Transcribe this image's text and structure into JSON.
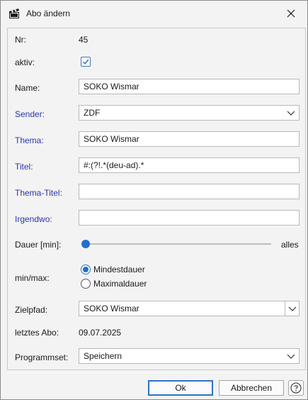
{
  "window": {
    "title": "Abo ändern",
    "app_icon": "clapperboard-icon",
    "close_icon": "close-icon"
  },
  "form": {
    "nr": {
      "label": "Nr:",
      "value": "45"
    },
    "aktiv": {
      "label": "aktiv:",
      "checked": true
    },
    "name": {
      "label": "Name:",
      "value": "SOKO Wismar"
    },
    "sender": {
      "label": "Sender:",
      "value": "ZDF"
    },
    "thema": {
      "label": "Thema:",
      "value": "SOKO Wismar"
    },
    "titel": {
      "label": "Titel:",
      "value": "#:(?!.*(deu-ad).*"
    },
    "thema_titel": {
      "label": "Thema-Titel:",
      "value": ""
    },
    "irgendwo": {
      "label": "Irgendwo:",
      "value": ""
    },
    "dauer": {
      "label": "Dauer [min]:",
      "end_label": "alles",
      "level": 0.0
    },
    "minmax": {
      "label": "min/max:",
      "options": [
        "Mindestdauer",
        "Maximaldauer"
      ],
      "selected": "Mindestdauer"
    },
    "zielpfad": {
      "label": "Zielpfad:",
      "value": "SOKO Wismar"
    },
    "letztes_abo": {
      "label": "letztes Abo:",
      "value": "09.07.2025"
    },
    "programmset": {
      "label": "Programmset:",
      "value": "Speichern"
    }
  },
  "footer": {
    "ok_label": "Ok",
    "cancel_label": "Abbrechen",
    "help_icon": "help-icon"
  },
  "colors": {
    "link_label": "#2a35b4",
    "accent": "#1f6fcf",
    "background": "#f3f3f3"
  }
}
